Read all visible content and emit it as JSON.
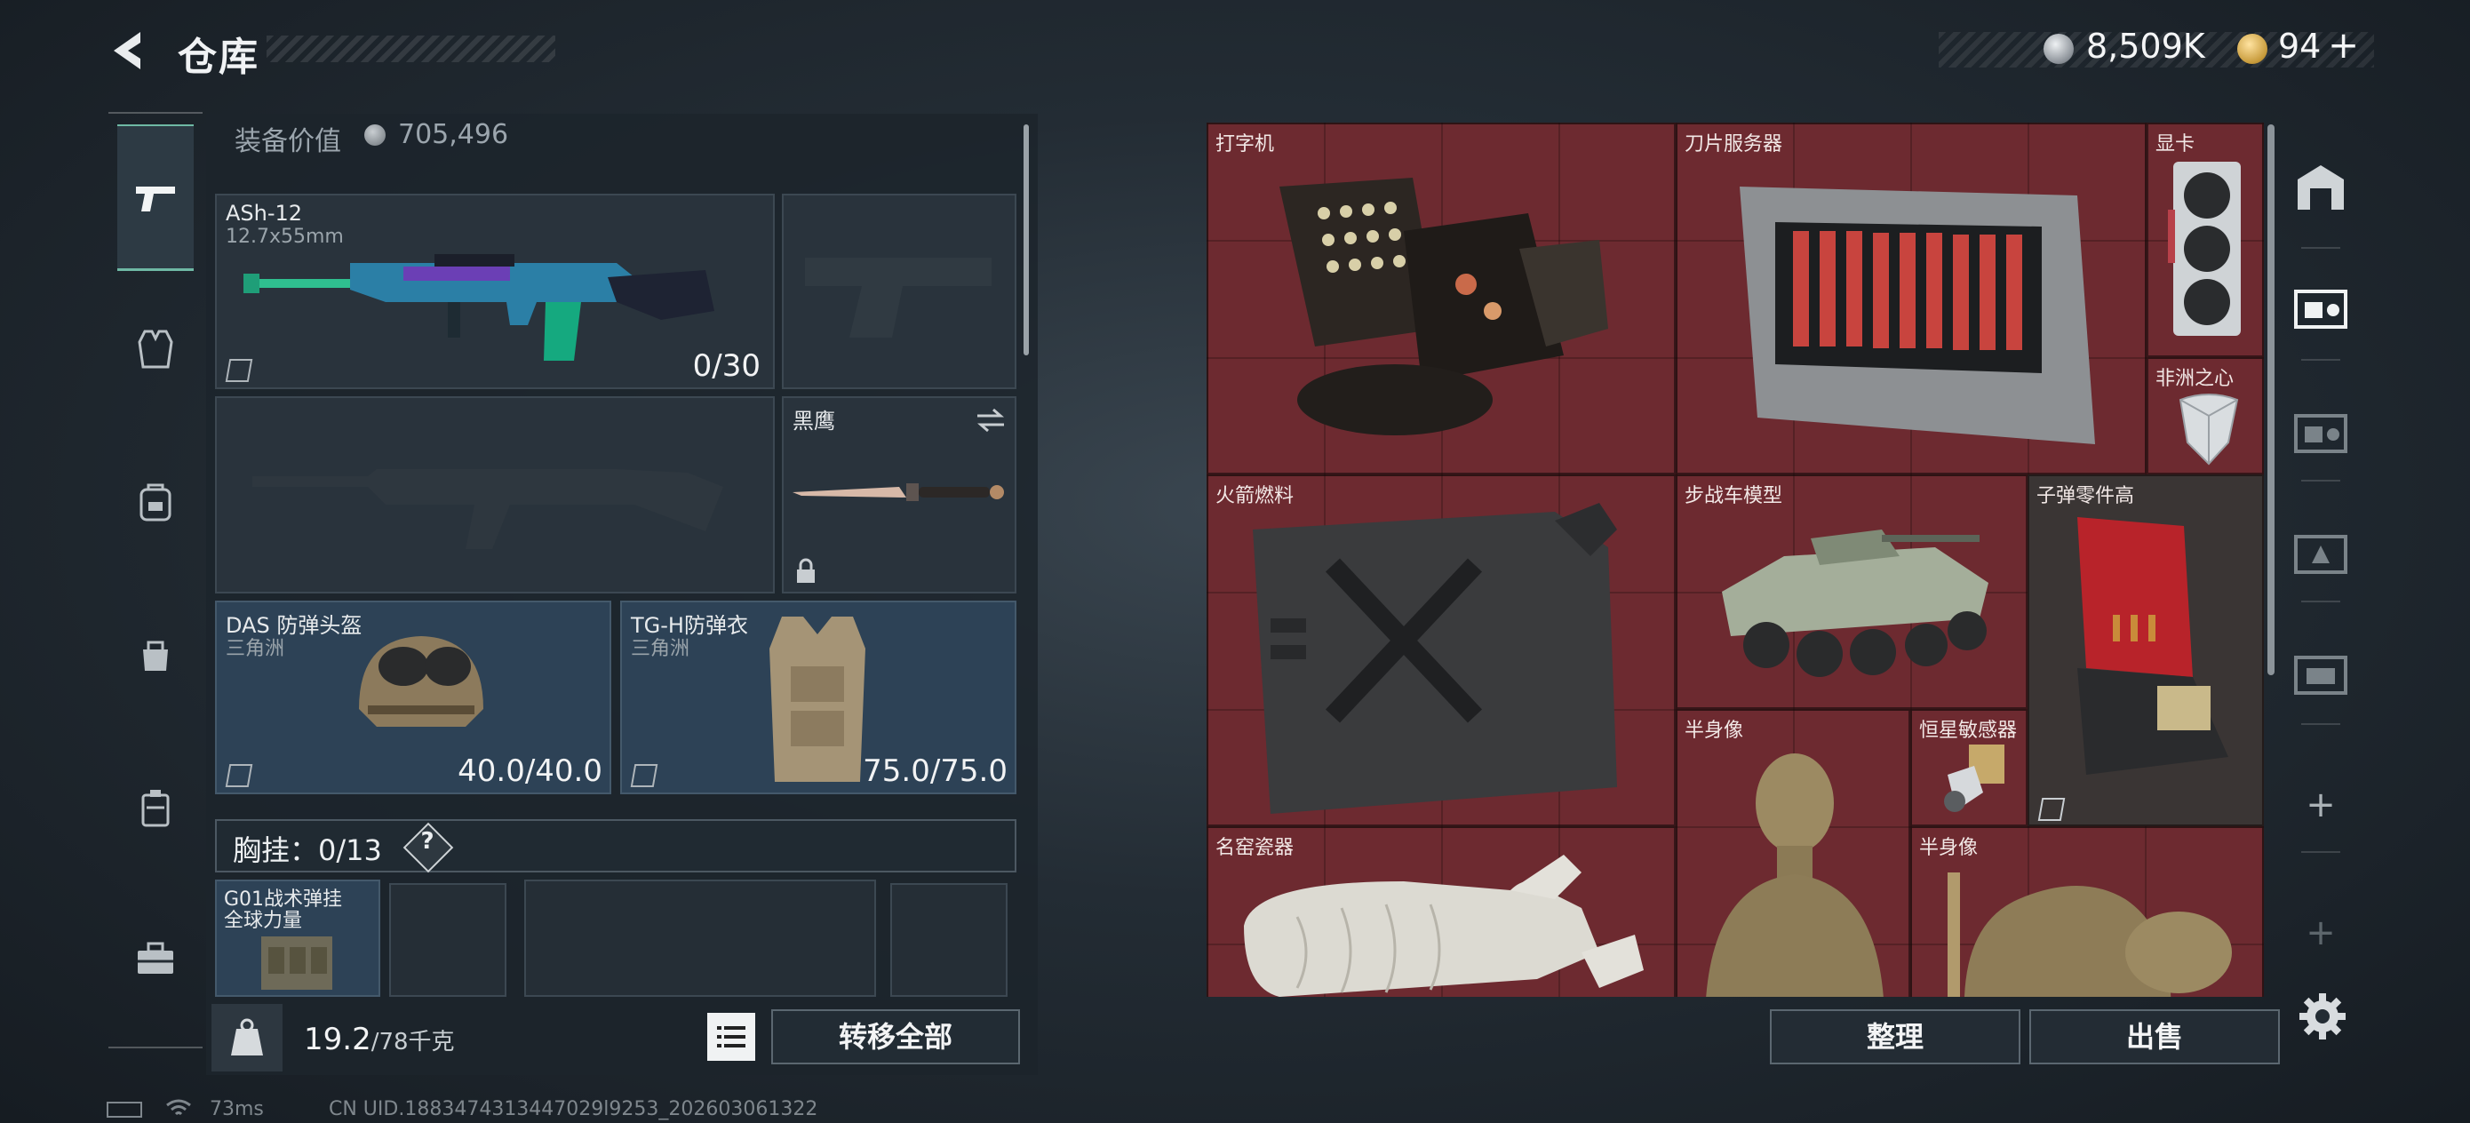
{
  "header": {
    "title": "仓库"
  },
  "currency": {
    "silver": "8,509K",
    "premium": "94",
    "premium_plus": "+"
  },
  "loadout": {
    "value_label": "装备价值",
    "value": "705,496",
    "primary": {
      "name": "ASh-12",
      "ammo_type": "12.7x55mm",
      "ammo": "0/30"
    },
    "melee": {
      "name": "黑鹰"
    },
    "helmet": {
      "name": "DAS 防弹头盔",
      "brand": "三角洲",
      "durability": "40.0/40.0"
    },
    "armor": {
      "name": "TG-H防弹衣",
      "brand": "三角洲",
      "durability": "75.0/75.0"
    },
    "rig": {
      "label": "胸挂：0/13",
      "help": "?"
    },
    "rig_item": {
      "name": "G01战术弹挂",
      "brand": "全球力量"
    },
    "weight": {
      "current": "19.2",
      "max": "/78千克"
    },
    "transfer_all": "转移全部"
  },
  "stash": {
    "items": [
      {
        "label": "打字机"
      },
      {
        "label": "刀片服务器"
      },
      {
        "label": "显卡"
      },
      {
        "label": "非洲之心"
      },
      {
        "label": "火箭燃料"
      },
      {
        "label": "步战车模型"
      },
      {
        "label": "子弹零件高"
      },
      {
        "label": "半身像"
      },
      {
        "label": "恒星敏感器"
      },
      {
        "label": "名窑瓷器"
      },
      {
        "label": "半身像"
      }
    ],
    "sort_button": "整理",
    "sell_button": "出售"
  },
  "side_rail": {
    "add_1": "+",
    "add_2": "+"
  },
  "status_bar": {
    "ping": "73ms",
    "uid": "CN UID.1883474313447029l9253_202603061322"
  }
}
